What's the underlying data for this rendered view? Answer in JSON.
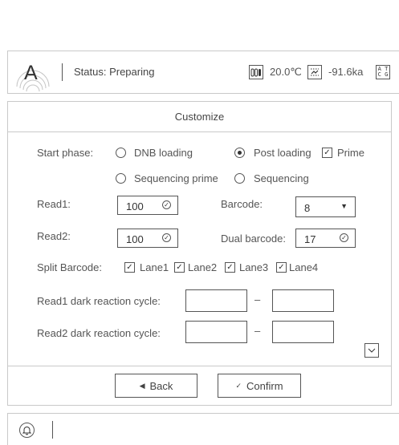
{
  "header": {
    "status_text": "Status: Preparing",
    "temperature": "20.0℃",
    "pressure": "-91.6ka",
    "dna_icon_top": "A T",
    "dna_icon_bottom": "C G",
    "logo_letter": "A"
  },
  "panel": {
    "title": "Customize",
    "start_phase": {
      "label": "Start phase:",
      "options": [
        "DNB loading",
        "Post loading",
        "Sequencing prime",
        "Sequencing"
      ],
      "selected": "Post loading",
      "prime_label": "Prime",
      "prime_checked": true
    },
    "read1": {
      "label": "Read1:",
      "value": "100"
    },
    "barcode": {
      "label": "Barcode:",
      "value": "8"
    },
    "read2": {
      "label": "Read2:",
      "value": "100"
    },
    "dual_barcode": {
      "label": "Dual barcode:",
      "value": "17"
    },
    "split_barcode": {
      "label": "Split Barcode:",
      "lanes": [
        "Lane1",
        "Lane2",
        "Lane3",
        "Lane4"
      ]
    },
    "read1_dark": {
      "label": "Read1 dark reaction cycle:",
      "from": "",
      "to": ""
    },
    "read2_dark": {
      "label": "Read2 dark reaction cycle:",
      "from": "",
      "to": ""
    },
    "dash": "–",
    "back_label": "Back",
    "confirm_label": "Confirm"
  },
  "colors": {
    "border": "#c9c9c9",
    "text": "#4a4a4a",
    "control": "#555555"
  }
}
